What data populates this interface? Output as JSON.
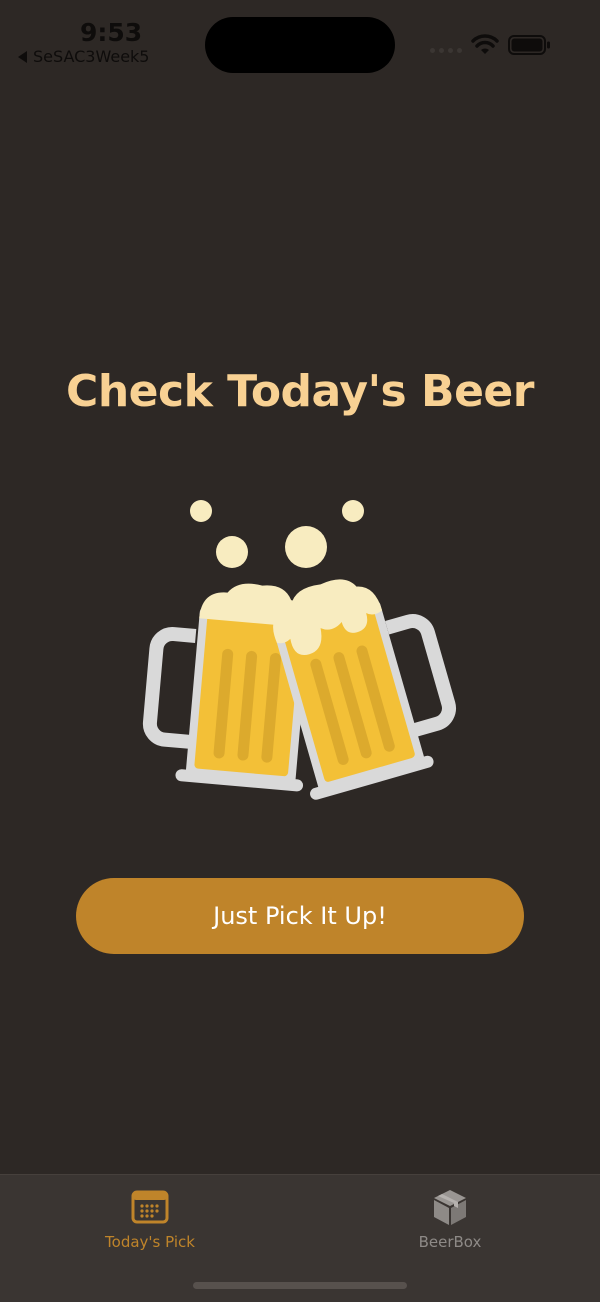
{
  "status_bar": {
    "time": "9:53",
    "back_app": "SeSAC3Week5",
    "icons": [
      "signal-icon",
      "wifi-icon",
      "battery-icon"
    ]
  },
  "main": {
    "title": "Check Today's Beer",
    "illustration": "beer-mugs-cheers-icon",
    "button_label": "Just Pick It Up!"
  },
  "tab_bar": {
    "tabs": [
      {
        "label": "Today's Pick",
        "icon": "calendar-icon",
        "selected": true
      },
      {
        "label": "BeerBox",
        "icon": "box-icon",
        "selected": false
      }
    ]
  },
  "colors": {
    "background": "#2d2825",
    "accent": "#bf842a",
    "title": "#f8d193",
    "tab_bar": "#3a3532",
    "tab_inactive": "#8e8a87"
  }
}
